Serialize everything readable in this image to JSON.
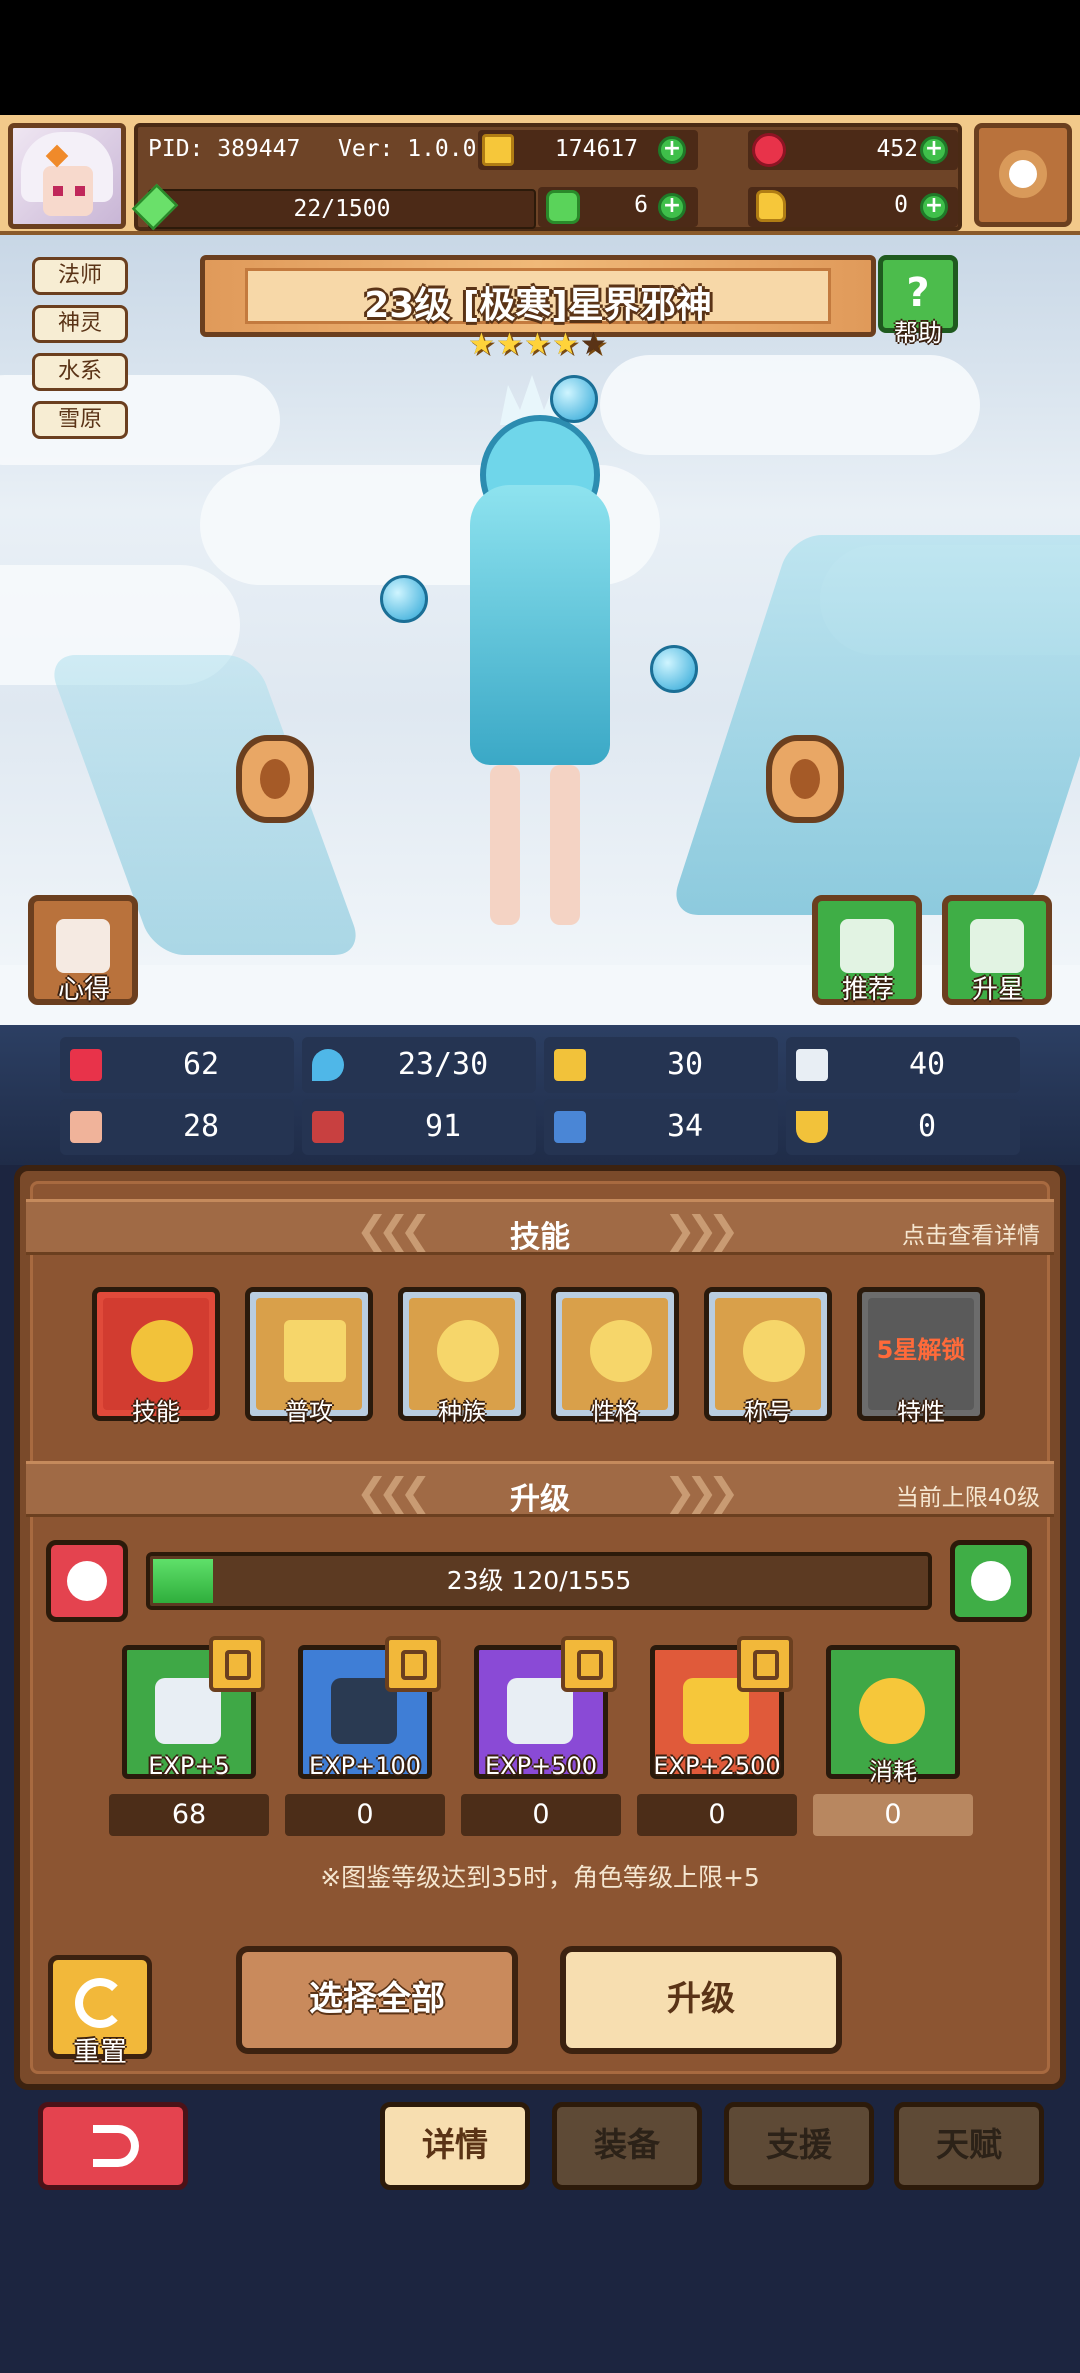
{
  "header": {
    "pid": "PID: 389447",
    "version": "Ver: 1.0.0.4",
    "gold": "174617",
    "ruby": "452",
    "energy": "22/1500",
    "energy_fraction": 0.0147,
    "clover": "6",
    "potion": "0"
  },
  "tags": [
    "法师",
    "神灵",
    "水系",
    "雪原"
  ],
  "character": {
    "title": "23级 [极寒]星界邪神",
    "stars_filled": 4,
    "stars_total": 5
  },
  "buttons": {
    "help": "帮助",
    "insight": "心得",
    "recommend": "推荐",
    "star_up": "升星",
    "reset": "重置",
    "select_all": "选择全部",
    "upgrade": "升级"
  },
  "stats": [
    "62",
    "23/30",
    "30",
    "40",
    "28",
    "91",
    "34",
    "0"
  ],
  "skills_section": {
    "title": "技能",
    "note": "点击查看详情",
    "items": [
      {
        "label": "技能"
      },
      {
        "label": "普攻"
      },
      {
        "label": "种族"
      },
      {
        "label": "性格"
      },
      {
        "label": "称号"
      },
      {
        "label": "特性",
        "lock_text": "5星解锁"
      }
    ]
  },
  "upgrade_section": {
    "title": "升级",
    "note": "当前上限40级",
    "progress_text": "23级  120/1555",
    "progress_fraction": 0.0772,
    "items": [
      {
        "label": "EXP+5",
        "count": "68"
      },
      {
        "label": "EXP+100",
        "count": "0"
      },
      {
        "label": "EXP+500",
        "count": "0"
      },
      {
        "label": "EXP+2500",
        "count": "0"
      },
      {
        "label": "消耗",
        "count": "0"
      }
    ],
    "footnote": "※图鉴等级达到35时，角色等级上限+5"
  },
  "tabs": [
    {
      "label": "详情",
      "active": true
    },
    {
      "label": "装备",
      "active": false
    },
    {
      "label": "支援",
      "active": false
    },
    {
      "label": "天赋",
      "active": false
    }
  ],
  "colors": {
    "accent_green": "#43b04c",
    "panel_brown": "#7a4a2a",
    "back_red": "#e4434f"
  }
}
